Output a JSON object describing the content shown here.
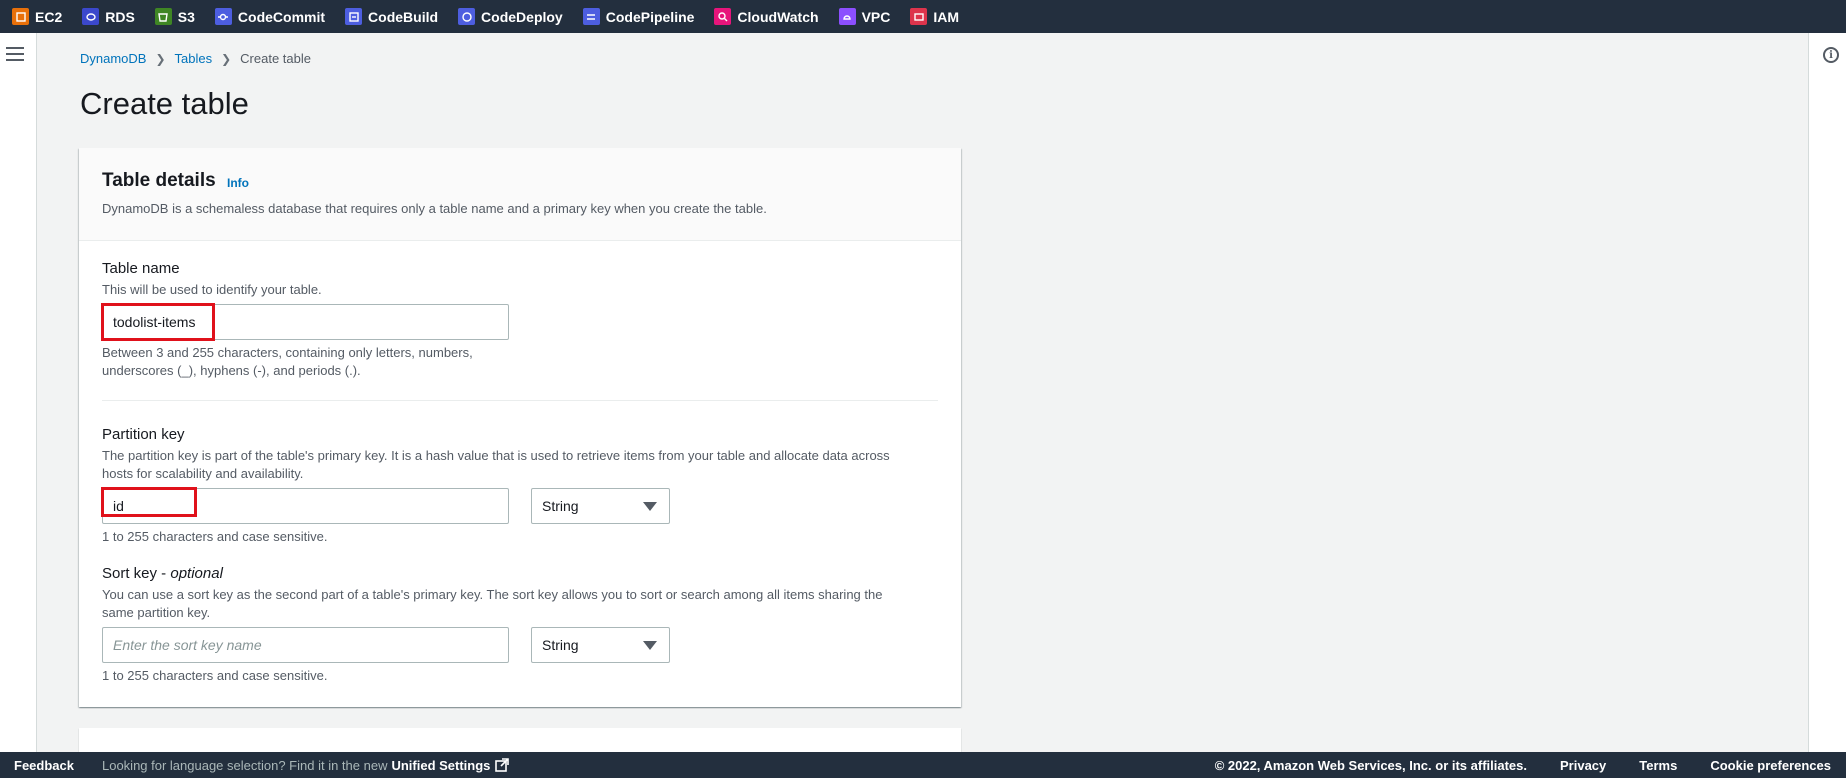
{
  "services": [
    {
      "label": "EC2",
      "color": "#e8700a",
      "icon": "ec2-icon"
    },
    {
      "label": "RDS",
      "color": "#3b48cc",
      "icon": "rds-icon"
    },
    {
      "label": "S3",
      "color": "#3f8624",
      "icon": "s3-icon"
    },
    {
      "label": "CodeCommit",
      "color": "#4d5ee0",
      "icon": "codecommit-icon"
    },
    {
      "label": "CodeBuild",
      "color": "#4d5ee0",
      "icon": "codebuild-icon"
    },
    {
      "label": "CodeDeploy",
      "color": "#4d5ee0",
      "icon": "codedeploy-icon"
    },
    {
      "label": "CodePipeline",
      "color": "#4d5ee0",
      "icon": "codepipeline-icon"
    },
    {
      "label": "CloudWatch",
      "color": "#e7157b",
      "icon": "cloudwatch-icon"
    },
    {
      "label": "VPC",
      "color": "#8c4fff",
      "icon": "vpc-icon"
    },
    {
      "label": "IAM",
      "color": "#dd344c",
      "icon": "iam-icon"
    }
  ],
  "breadcrumb": {
    "items": [
      "DynamoDB",
      "Tables"
    ],
    "current": "Create table"
  },
  "page": {
    "title": "Create table"
  },
  "table_details": {
    "title": "Table details",
    "info": "Info",
    "description": "DynamoDB is a schemaless database that requires only a table name and a primary key when you create the table."
  },
  "table_name": {
    "label": "Table name",
    "description": "This will be used to identify your table.",
    "value": "todolist-items",
    "constraint_line1": "Between 3 and 255 characters, containing only letters, numbers,",
    "constraint_line2": "underscores (_), hyphens (-), and periods (.)."
  },
  "partition_key": {
    "label": "Partition key",
    "description_line1": "The partition key is part of the table's primary key. It is a hash value that is used to retrieve items from your table and allocate data across",
    "description_line2": "hosts for scalability and availability.",
    "value": "id",
    "type": "String",
    "constraint": "1 to 255 characters and case sensitive."
  },
  "sort_key": {
    "label": "Sort key - ",
    "label_optional": "optional",
    "description_line1": "You can use a sort key as the second part of a table's primary key. The sort key allows you to sort or search among all items sharing the",
    "description_line2": "same partition key.",
    "placeholder": "Enter the sort key name",
    "type": "String",
    "constraint": "1 to 255 characters and case sensitive."
  },
  "footer": {
    "feedback": "Feedback",
    "language_prompt": "Looking for language selection? Find it in the new",
    "unified_settings": "Unified Settings",
    "copyright": "© 2022, Amazon Web Services, Inc. or its affiliates.",
    "privacy": "Privacy",
    "terms": "Terms",
    "cookie_preferences": "Cookie preferences"
  },
  "colors": {
    "topbar": "#232f3e",
    "link": "#0073bb",
    "highlight": "#e0111b"
  }
}
